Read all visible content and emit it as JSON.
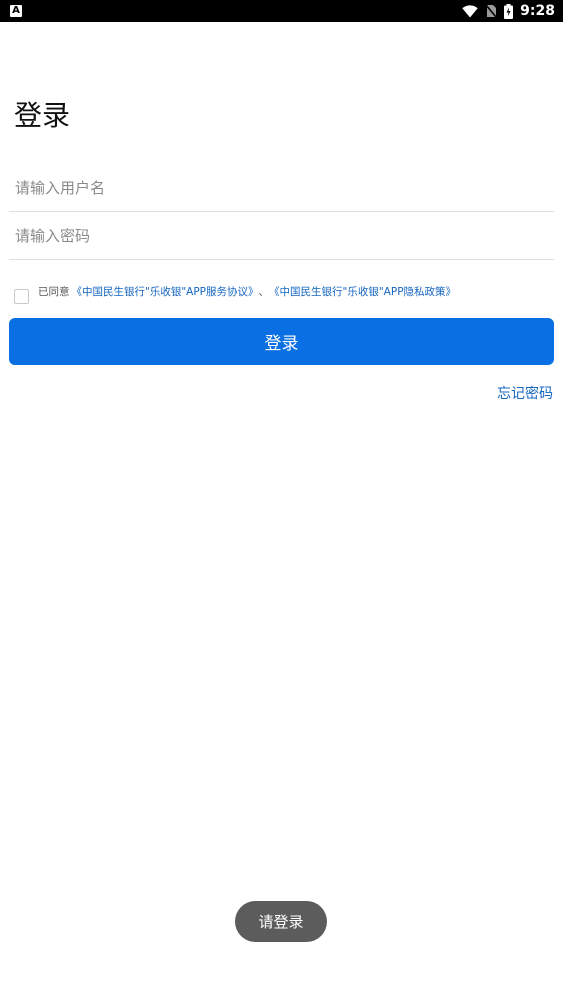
{
  "status_bar": {
    "left_icon_letter": "A",
    "time": "9:28",
    "icons": [
      "wifi-icon",
      "no-sim-icon",
      "battery-charging-icon"
    ]
  },
  "page": {
    "title": "登录"
  },
  "form": {
    "username_placeholder": "请输入用户名",
    "username_value": "",
    "password_placeholder": "请输入密码",
    "password_value": "",
    "agreement_checked": false,
    "agreement_prefix": "已同意",
    "agreement_link_1": "《中国民生银行\"乐收银\"APP服务协议》",
    "agreement_separator": "、",
    "agreement_link_2": "《中国民生银行\"乐收银\"APP隐私政策》",
    "login_label": "登录",
    "forgot_label": "忘记密码"
  },
  "toast": {
    "message": "请登录"
  },
  "colors": {
    "primary": "#0a6fe3",
    "link": "#1565c0",
    "toast_bg": "#5c5c5c"
  }
}
